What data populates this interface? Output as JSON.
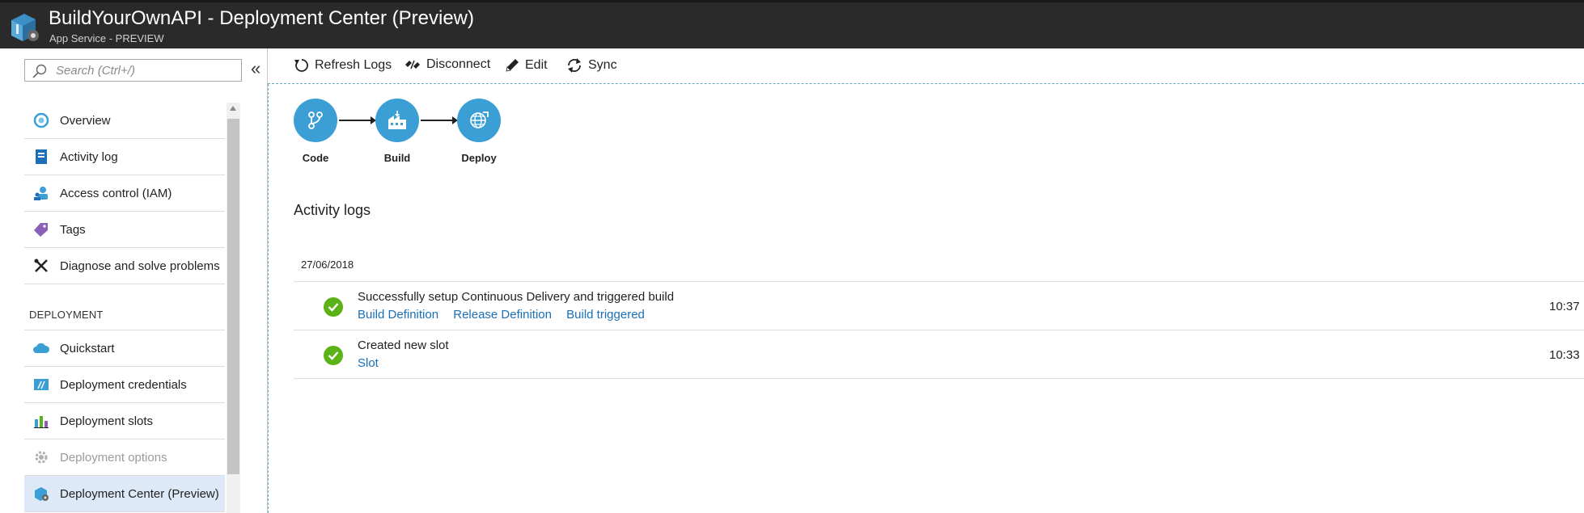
{
  "window": {
    "title": "BuildYourOwnAPI - Deployment Center (Preview)",
    "subtitle": "App Service - PREVIEW",
    "app_icon": "app-service-icon"
  },
  "sidebar": {
    "search_placeholder": "Search (Ctrl+/)",
    "collapse_label": "«",
    "items_top": [
      {
        "label": "Overview",
        "icon": "overview-icon"
      },
      {
        "label": "Activity log",
        "icon": "activity-log-icon"
      },
      {
        "label": "Access control (IAM)",
        "icon": "access-control-icon"
      },
      {
        "label": "Tags",
        "icon": "tag-icon"
      },
      {
        "label": "Diagnose and solve problems",
        "icon": "tools-icon"
      }
    ],
    "section_label": "DEPLOYMENT",
    "items_deployment": [
      {
        "label": "Quickstart",
        "icon": "cloud-icon"
      },
      {
        "label": "Deployment credentials",
        "icon": "credentials-icon"
      },
      {
        "label": "Deployment slots",
        "icon": "slots-icon"
      },
      {
        "label": "Deployment options",
        "icon": "gear-icon",
        "disabled": true
      },
      {
        "label": "Deployment Center (Preview)",
        "icon": "deployment-center-icon",
        "selected": true
      }
    ]
  },
  "toolbar": {
    "refresh_label": "Refresh Logs",
    "disconnect_label": "Disconnect",
    "edit_label": "Edit",
    "sync_label": "Sync"
  },
  "pipeline": {
    "steps": [
      {
        "label": "Code",
        "icon": "branch-icon"
      },
      {
        "label": "Build",
        "icon": "factory-icon"
      },
      {
        "label": "Deploy",
        "icon": "globe-icon"
      }
    ]
  },
  "activity": {
    "title": "Activity logs",
    "date": "27/06/2018",
    "entries": [
      {
        "message": "Successfully setup Continuous Delivery and triggered build",
        "links": [
          "Build Definition",
          "Release Definition",
          "Build triggered"
        ],
        "time": "10:37",
        "status_color": "#5cb317"
      },
      {
        "message": "Created new slot",
        "links": [
          "Slot"
        ],
        "time": "10:33",
        "status_color": "#5cb317"
      }
    ]
  },
  "colors": {
    "accent": "#3b9fd6",
    "link": "#1a6fb5",
    "titlebar": "#2a2a2a",
    "selected_bg": "#dde9f6",
    "success": "#5cb317"
  }
}
